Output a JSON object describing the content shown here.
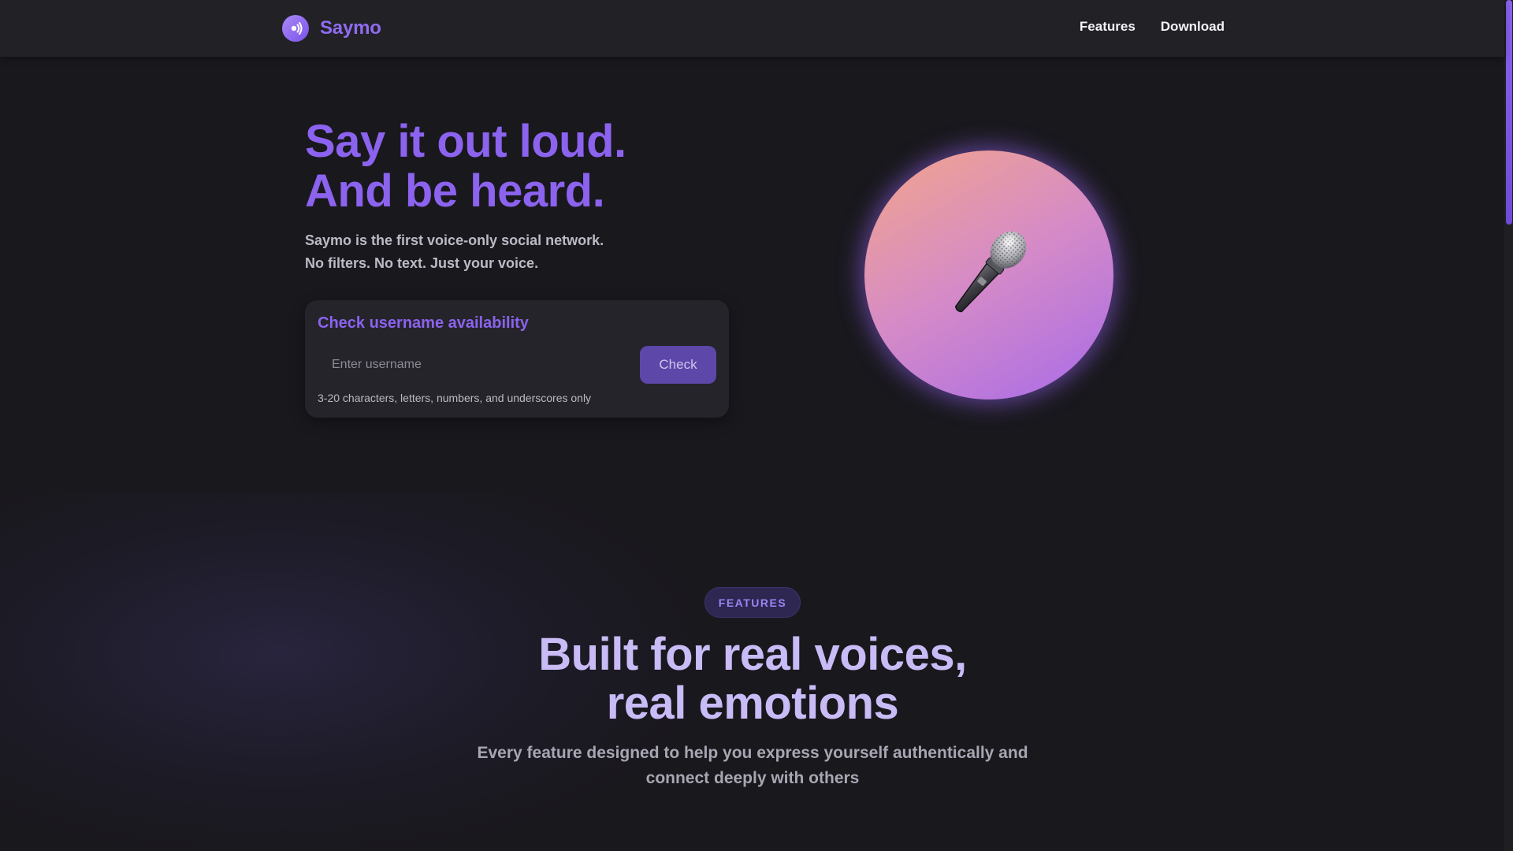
{
  "nav": {
    "brand_name": "Saymo",
    "links": [
      {
        "label": "Features"
      },
      {
        "label": "Download"
      }
    ]
  },
  "hero": {
    "title_line1": "Say it out loud.",
    "title_line2": "And be heard.",
    "subtitle_line1": "Saymo is the first voice-only social network.",
    "subtitle_line2": "No filters. No text. Just your voice.",
    "check_card": {
      "title": "Check username availability",
      "input_placeholder": "Enter username",
      "input_value": "",
      "button_label": "Check",
      "hint": "3-20 characters, letters, numbers, and underscores only"
    },
    "illustration_icon": "microphone-icon"
  },
  "features": {
    "badge": "FEATURES",
    "title_line1": "Built for real voices,",
    "title_line2": "real emotions",
    "subtitle_line1": "Every feature designed to help you express yourself authentically and",
    "subtitle_line2": "connect deeply with others"
  },
  "colors": {
    "accent": "#8b63ee",
    "background": "#19181d",
    "nav_background": "#222126",
    "button": "#5d47a8",
    "orb_gradient_start": "#f2a58a",
    "orb_gradient_end": "#a86be9"
  }
}
